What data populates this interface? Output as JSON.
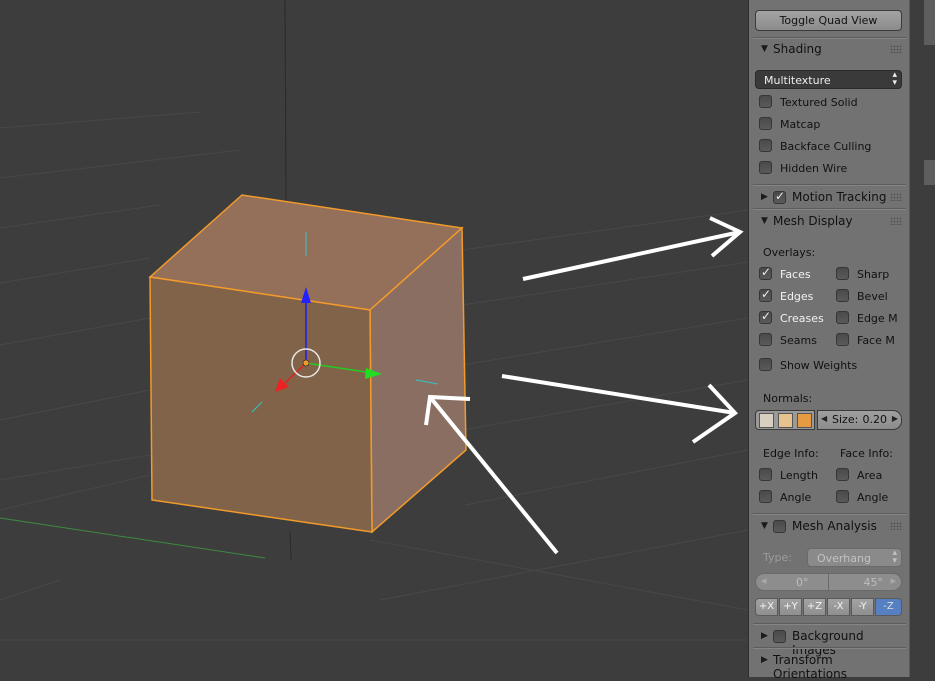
{
  "panel": {
    "toggle_quad_view": "Toggle Quad View",
    "shading": {
      "title": "Shading",
      "dropdown_value": "Multitexture",
      "options": [
        "Textured Solid",
        "Matcap",
        "Backface Culling",
        "Hidden Wire"
      ]
    },
    "motion_tracking": {
      "title": "Motion Tracking",
      "checked": true
    },
    "mesh_display": {
      "title": "Mesh Display",
      "overlays_label": "Overlays:",
      "left_options": [
        {
          "label": "Faces",
          "checked": true
        },
        {
          "label": "Edges",
          "checked": true
        },
        {
          "label": "Creases",
          "checked": true
        },
        {
          "label": "Seams",
          "checked": false
        }
      ],
      "right_options": [
        {
          "label": "Sharp",
          "checked": false
        },
        {
          "label": "Bevel",
          "checked": false
        },
        {
          "label": "Edge M",
          "checked": false
        },
        {
          "label": "Face M",
          "checked": false
        }
      ],
      "show_weights": "Show Weights",
      "normals_label": "Normals:",
      "size_label": "Size:",
      "size_value": "0.20",
      "edge_info_label": "Edge Info:",
      "face_info_label": "Face Info:",
      "edge_info": [
        "Length",
        "Angle"
      ],
      "face_info": [
        "Area",
        "Angle"
      ]
    },
    "mesh_analysis": {
      "title": "Mesh Analysis",
      "type_label": "Type:",
      "type_value": "Overhang",
      "min_angle": "0°",
      "max_angle": "45°",
      "axes": [
        "+X",
        "+Y",
        "+Z",
        "-X",
        "-Y",
        "-Z"
      ],
      "active_axis": "-Z"
    },
    "background_images": {
      "title": "Background Images"
    },
    "transform_orientations": {
      "title": "Transform Orientations"
    }
  },
  "icons": {
    "collapse": "triangle-down-icon",
    "expand": "triangle-right-icon",
    "check": "checkmark-icon",
    "dropdown": "updown-arrows-icon"
  },
  "colors": {
    "viewport_bg": "#3d3d3d",
    "panel_bg": "#727272",
    "cube_selection": "#f29a2a",
    "active_axis": "#5680c2"
  }
}
